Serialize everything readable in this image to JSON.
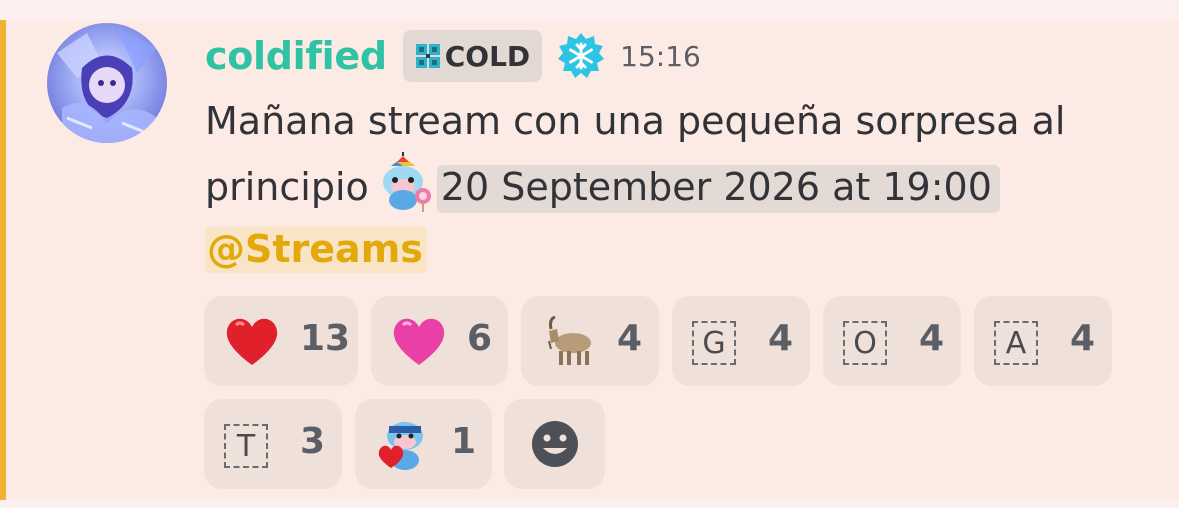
{
  "message": {
    "author": {
      "username": "coldified",
      "tag_label": "COLD",
      "tag_icon": "clover-tag-icon",
      "badge_icon": "snowflake-icon",
      "username_color": "#2fc2a5"
    },
    "timestamp": "15:16",
    "content": {
      "text_line1": "Mañana stream con una pequeña sorpresa al",
      "text_word": "principio",
      "inline_emoji": "candy-mascot-emoji",
      "scheduled_time": "20 September 2026 at 19:00",
      "mention": "@Streams"
    },
    "accent_color": "#f0b232"
  },
  "reactions": [
    {
      "emoji": "red-heart",
      "count": "13"
    },
    {
      "emoji": "pink-heart",
      "count": "6"
    },
    {
      "emoji": "goat",
      "count": "4"
    },
    {
      "emoji": "letter-G",
      "glyph": "G",
      "count": "4"
    },
    {
      "emoji": "letter-O",
      "glyph": "O",
      "count": "4"
    },
    {
      "emoji": "letter-A",
      "glyph": "A",
      "count": "4"
    },
    {
      "emoji": "letter-T",
      "glyph": "T",
      "count": "3"
    },
    {
      "emoji": "heart-mascot",
      "count": "1"
    }
  ],
  "add_reaction_icon": "add-reaction-smile-icon"
}
